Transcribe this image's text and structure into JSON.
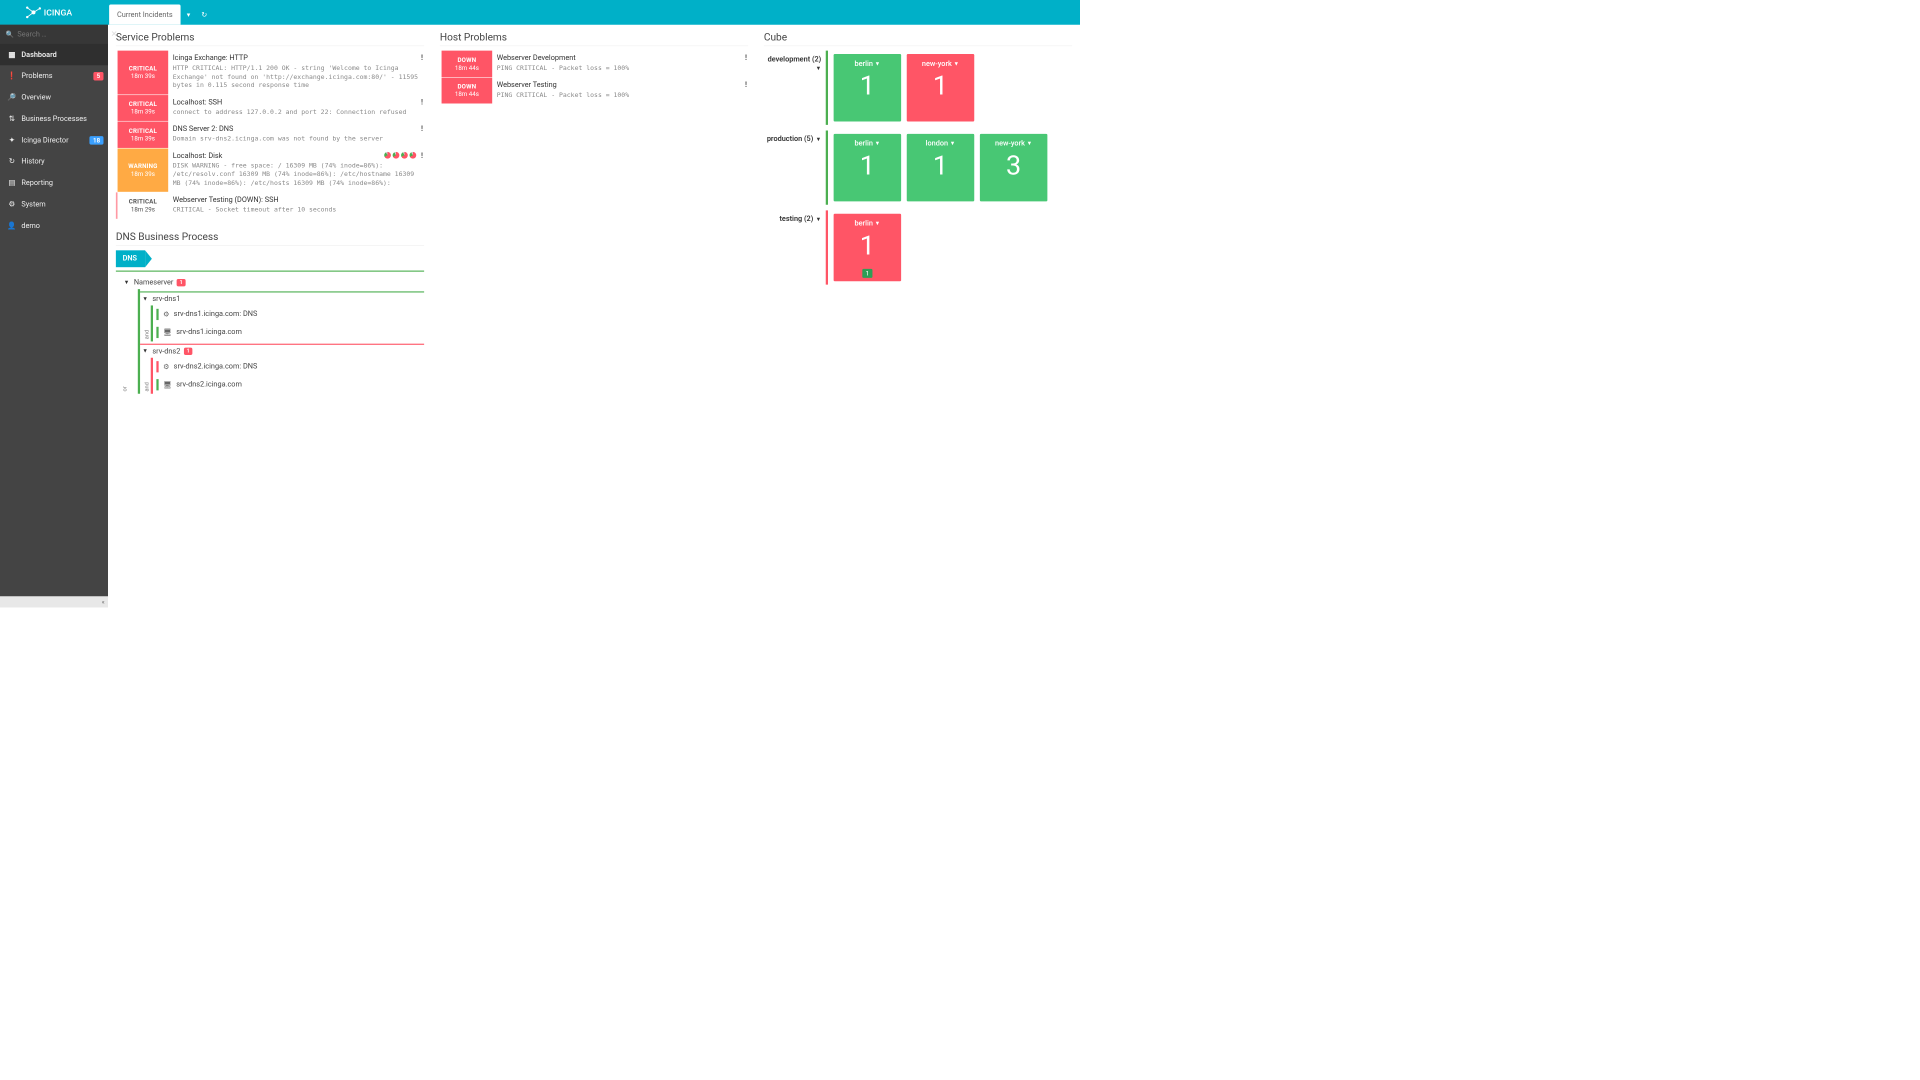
{
  "search_placeholder": "Search …",
  "nav": [
    {
      "label": "Dashboard",
      "icon": "▦",
      "active": true
    },
    {
      "label": "Problems",
      "icon": "❗",
      "badge": "5",
      "badgeColor": "red"
    },
    {
      "label": "Overview",
      "icon": "🔎"
    },
    {
      "label": "Business Processes",
      "icon": "⇅"
    },
    {
      "label": "Icinga Director",
      "icon": "✦",
      "badge": "18",
      "badgeColor": "blue"
    },
    {
      "label": "History",
      "icon": "↻"
    },
    {
      "label": "Reporting",
      "icon": "▤"
    },
    {
      "label": "System",
      "icon": "⚙"
    },
    {
      "label": "demo",
      "icon": "👤"
    }
  ],
  "tab_label": "Current Incidents",
  "sections": {
    "service": "Service Problems",
    "host": "Host Problems",
    "cube": "Cube",
    "bp": "DNS Business Process"
  },
  "service_problems": [
    {
      "state": "CRITICAL",
      "cls": "state-critical",
      "ts": "18m 39s",
      "title": "Icinga Exchange: HTTP",
      "out": "HTTP CRITICAL: HTTP/1.1 200 OK - string 'Welcome to Icinga Exchange' not found on 'http://exchange.icinga.com:80/' - 11595 bytes in 0.115 second response time",
      "urgent": true
    },
    {
      "state": "CRITICAL",
      "cls": "state-critical",
      "ts": "18m 39s",
      "title": "Localhost: SSH",
      "out": "connect to address 127.0.0.2 and port 22: Connection refused",
      "urgent": true
    },
    {
      "state": "CRITICAL",
      "cls": "state-critical",
      "ts": "18m 39s",
      "title": "DNS Server 2: DNS",
      "out": "Domain srv-dns2.icinga.com was not found by the server",
      "urgent": true
    },
    {
      "state": "WARNING",
      "cls": "state-warning",
      "ts": "18m 39s",
      "title": "Localhost: Disk",
      "out": "DISK WARNING - free space: / 16309 MB (74% inode=86%): /etc/resolv.conf 16309 MB (74% inode=86%): /etc/hostname 16309 MB (74% inode=86%): /etc/hosts 16309 MB (74% inode=86%):",
      "urgent": true,
      "pies": true
    },
    {
      "state": "CRITICAL",
      "cls": "state-soft",
      "soft": true,
      "ts": "18m 29s",
      "title": "Webserver Testing (DOWN): SSH",
      "out": "CRITICAL - Socket timeout after 10 seconds"
    }
  ],
  "host_problems": [
    {
      "state": "DOWN",
      "cls": "state-down",
      "ts": "18m 44s",
      "title": "Webserver Development",
      "out": "PING CRITICAL - Packet loss = 100%",
      "urgent": true
    },
    {
      "state": "DOWN",
      "cls": "state-down",
      "ts": "18m 44s",
      "title": "Webserver Testing",
      "out": "PING CRITICAL - Packet loss = 100%",
      "urgent": true
    }
  ],
  "bp": {
    "root_label": "DNS",
    "nameserver_label": "Nameserver",
    "nameserver_count": "1",
    "srv1": {
      "name": "srv-dns1",
      "svc": "srv-dns1.icinga.com: DNS",
      "host": "srv-dns1.icinga.com"
    },
    "srv2": {
      "name": "srv-dns2",
      "count": "1",
      "svc": "srv-dns2.icinga.com: DNS",
      "host": "srv-dns2.icinga.com"
    },
    "op_or": "or",
    "op_and": "and"
  },
  "cube": [
    {
      "label": "development (2)",
      "border": "green",
      "cells": [
        {
          "name": "berlin",
          "num": "1",
          "color": "green"
        },
        {
          "name": "new-york",
          "num": "1",
          "color": "red"
        }
      ]
    },
    {
      "label": "production (5)",
      "border": "green",
      "cells": [
        {
          "name": "berlin",
          "num": "1",
          "color": "green"
        },
        {
          "name": "london",
          "num": "1",
          "color": "green"
        },
        {
          "name": "new-york",
          "num": "3",
          "color": "green"
        }
      ]
    },
    {
      "label": "testing (2)",
      "border": "red",
      "cells": [
        {
          "name": "berlin",
          "num": "1",
          "color": "red",
          "sub": "1"
        }
      ]
    }
  ]
}
